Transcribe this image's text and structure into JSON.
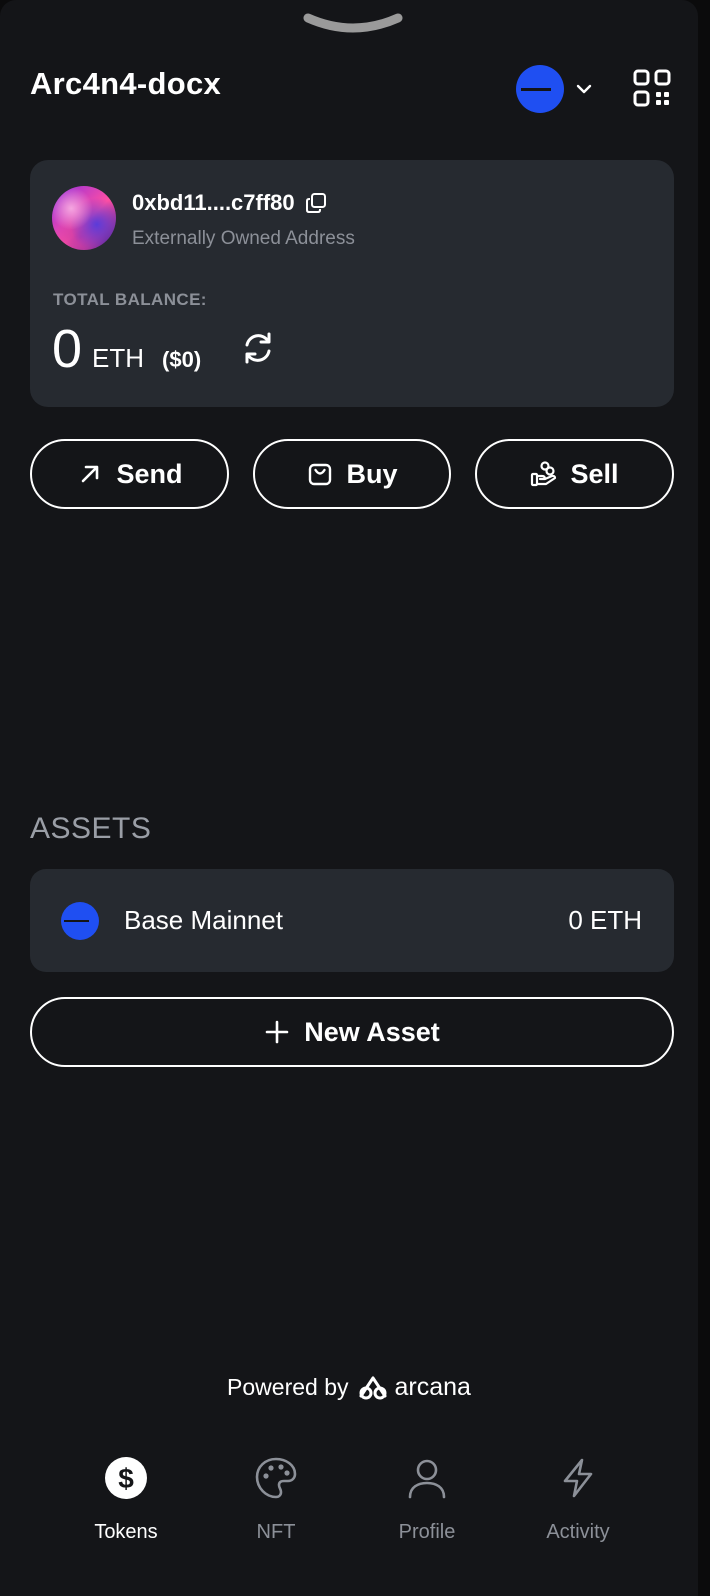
{
  "header": {
    "title": "Arc4n4-docx",
    "network_icon": "base-network-icon",
    "qr_icon": "qr-code-icon"
  },
  "account": {
    "address": "0xbd11....c7ff80",
    "address_type": "Externally Owned Address",
    "balance_label": "TOTAL BALANCE:",
    "balance_value": "0",
    "balance_unit": "ETH",
    "balance_fiat": "($0)"
  },
  "actions": {
    "send_label": "Send",
    "buy_label": "Buy",
    "sell_label": "Sell"
  },
  "assets": {
    "heading": "ASSETS",
    "items": [
      {
        "name": "Base Mainnet",
        "amount": "0 ETH"
      }
    ],
    "new_asset_label": "New Asset"
  },
  "footer": {
    "powered_by": "Powered by",
    "brand": "arcana"
  },
  "nav": {
    "items": [
      {
        "label": "Tokens",
        "icon": "dollar-icon",
        "active": true
      },
      {
        "label": "NFT",
        "icon": "palette-icon",
        "active": false
      },
      {
        "label": "Profile",
        "icon": "user-icon",
        "active": false
      },
      {
        "label": "Activity",
        "icon": "lightning-icon",
        "active": false
      }
    ]
  },
  "colors": {
    "background": "#141518",
    "card": "#262a30",
    "network_blue": "#1f4ff2",
    "muted_text": "#8c9098"
  }
}
